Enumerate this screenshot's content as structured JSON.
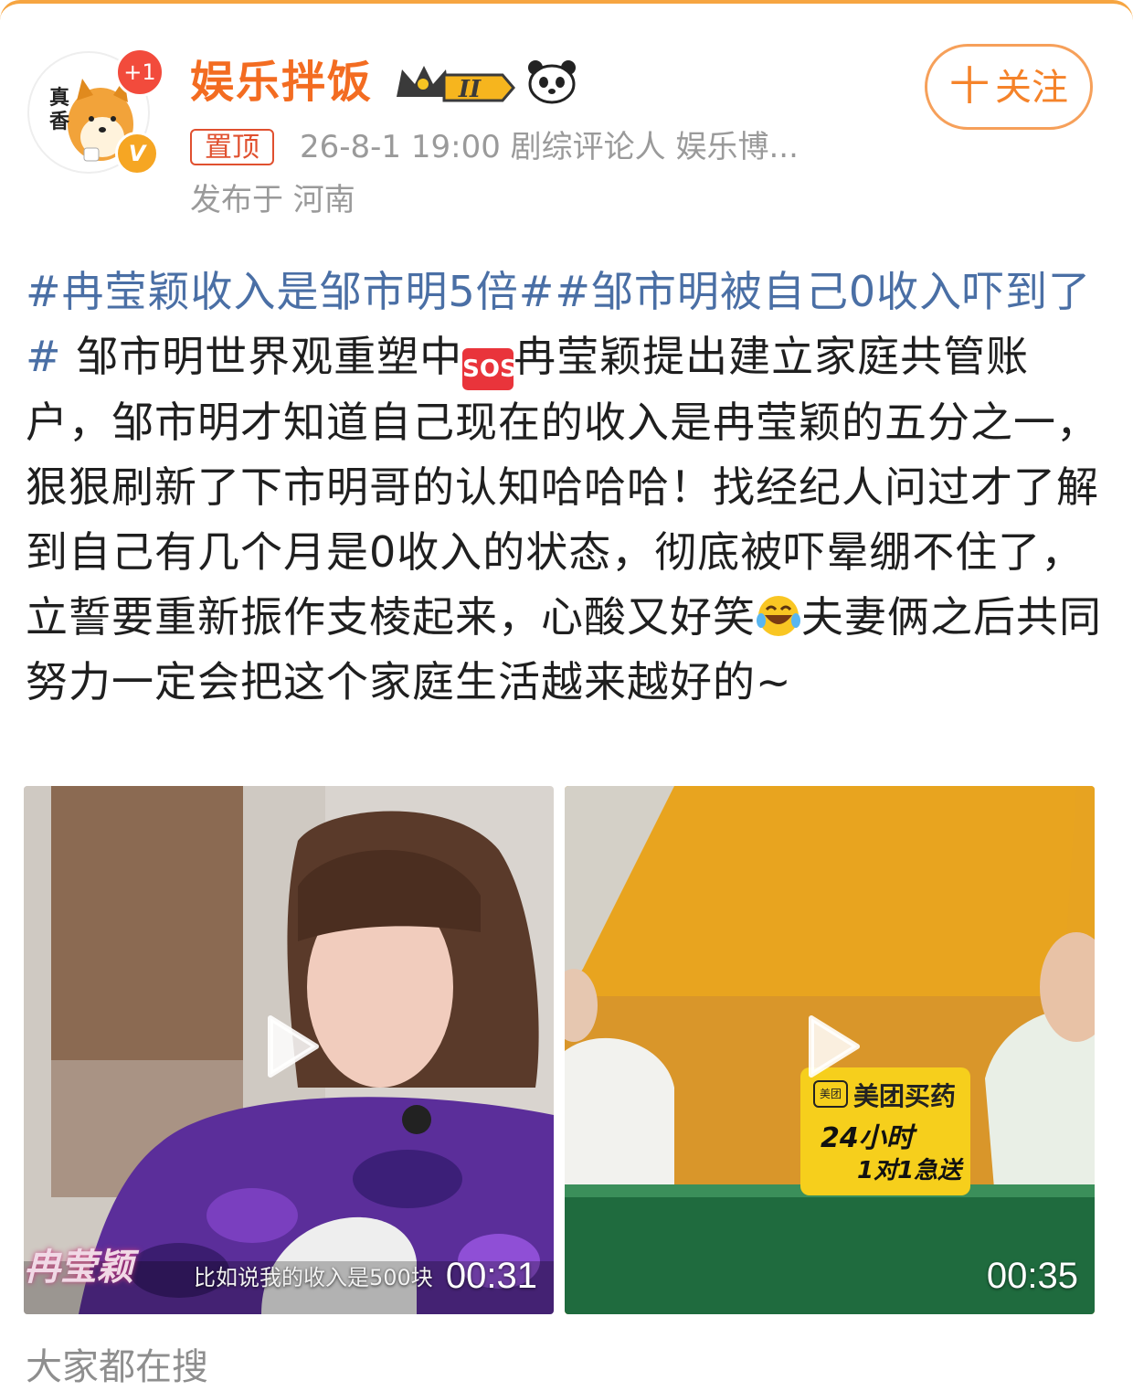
{
  "post": {
    "author": {
      "name": "娱乐拌饭",
      "avatar_text": "真香",
      "notification_badge": "+1",
      "verified_badge": "V",
      "level_badge": "II"
    },
    "follow_button": {
      "label": "关注",
      "plus": "十"
    },
    "pinned_label": "置顶",
    "meta_line": "26-8-1 19:00   剧综评论人 娱乐博...",
    "location": "发布于 河南",
    "content": {
      "hashtag1": "#冉莹颖收入是邹市明5倍#",
      "hashtag2": "#邹市明被自己0收入吓到了#",
      "text1": " 邹市明世界观重塑中",
      "sos": "SOS",
      "text2": "冉莹颖提出建立家庭共管账户，邹市明才知道自己现在的收入是冉莹颖的五分之一，狠狠刷新了下市明哥的认知哈哈哈！找经纪人问过才了解到自己有几个月是0收入的状态，彻底被吓晕绷不住了，立誓要重新振作支棱起来，心酸又好笑",
      "text3": "夫妻俩之后共同努力一定会把这个家庭生活越来越好的~"
    },
    "videos": [
      {
        "duration": "00:31",
        "subtitle": "比如说我的收入是500块",
        "name_caption": "冉莹颖"
      },
      {
        "duration": "00:35",
        "ad_logo": "美团",
        "ad_title": "美团买药",
        "ad_line1": "24小时",
        "ad_line2": "1对1急送"
      }
    ]
  },
  "footer": {
    "label": "大家都在搜"
  },
  "colors": {
    "brand_orange": "#f36c21",
    "hashtag_blue": "#4a6fa5",
    "meta_gray": "#9a9a9a",
    "pinned_red": "#e0502f"
  }
}
